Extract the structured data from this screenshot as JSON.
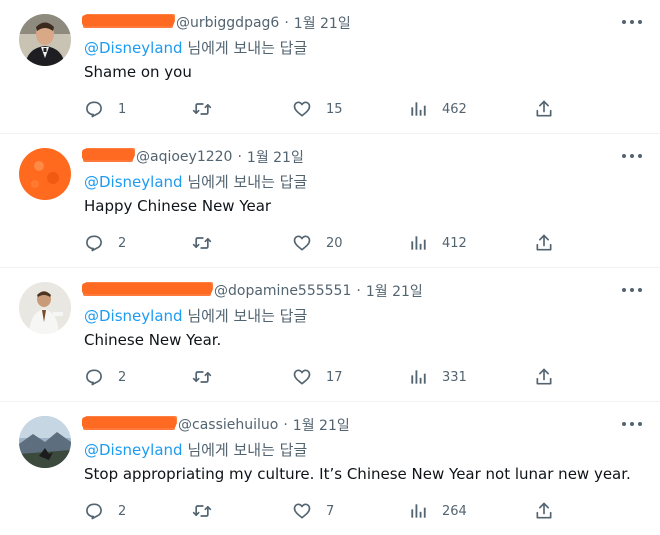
{
  "colors": {
    "accent": "#1d9bf0",
    "muted": "#536471",
    "redaction": "#ff6a22"
  },
  "tweets": [
    {
      "handle": "@urbiggdpag6",
      "time": "1월 21일",
      "reply_to": "@Disneyland",
      "reply_suffix": "님에게 보내는 답글",
      "text": "Shame on you",
      "replies": "1",
      "retweets": "",
      "likes": "15",
      "views": "462",
      "avatar": "man-in-suit-avatar"
    },
    {
      "handle": "@aqioey1220",
      "time": "1월 21일",
      "reply_to": "@Disneyland",
      "reply_suffix": "님에게 보내는 답글",
      "text": "Happy Chinese New Year",
      "replies": "2",
      "retweets": "",
      "likes": "20",
      "views": "412",
      "avatar": "orange-redacted-avatar"
    },
    {
      "handle": "@dopamine555551",
      "time": "1월 21일",
      "reply_to": "@Disneyland",
      "reply_suffix": "님에게 보내는 답글",
      "text": "Chinese New Year.",
      "replies": "2",
      "retweets": "",
      "likes": "17",
      "views": "331",
      "avatar": "man-white-shirt-avatar"
    },
    {
      "handle": "@cassiehuiluo",
      "time": "1월 21일",
      "reply_to": "@Disneyland",
      "reply_suffix": "님에게 보내는 답글",
      "text": "Stop appropriating my culture. It’s Chinese New Year not lunar new year.",
      "replies": "2",
      "retweets": "",
      "likes": "7",
      "views": "264",
      "avatar": "landscape-photo-avatar"
    }
  ]
}
